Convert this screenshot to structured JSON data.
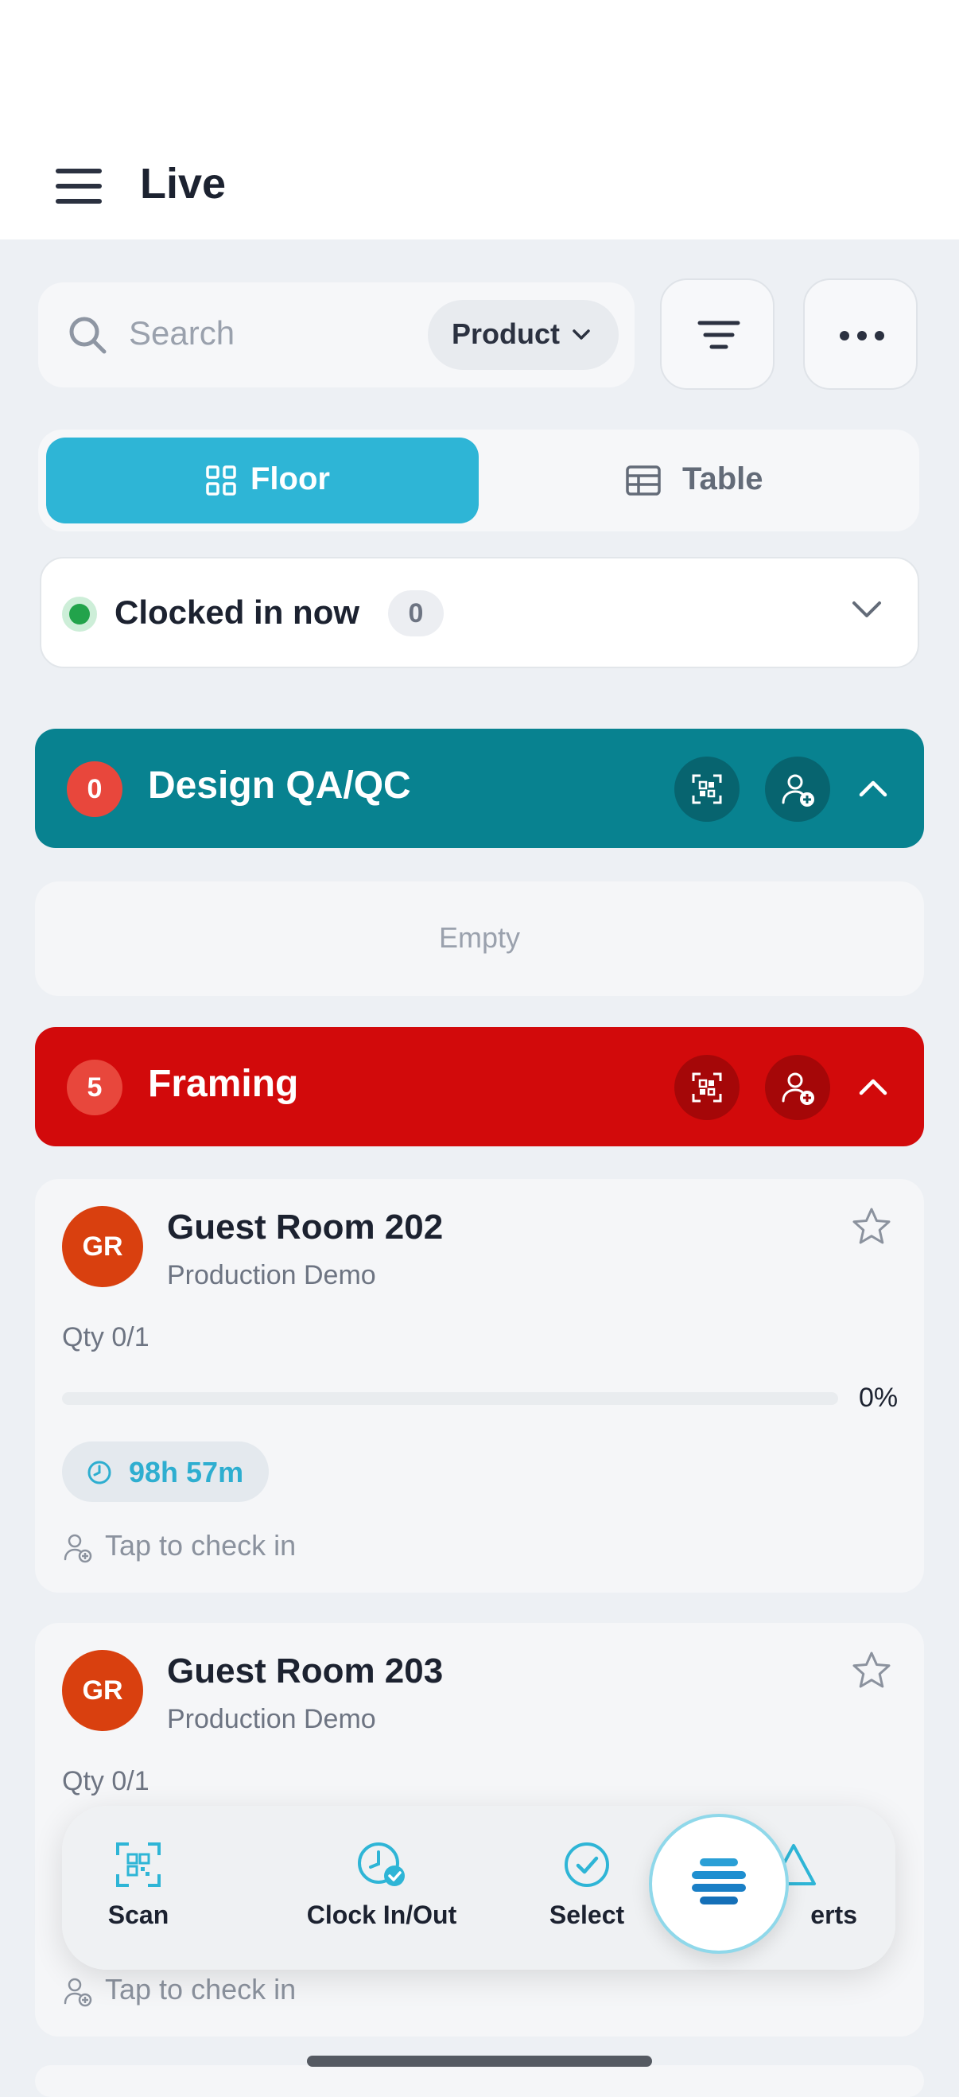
{
  "header": {
    "title": "Live"
  },
  "search": {
    "placeholder": "Search",
    "filter_label": "Product"
  },
  "view_toggle": {
    "floor_label": "Floor",
    "table_label": "Table"
  },
  "clocked_in": {
    "label": "Clocked in now",
    "count": "0"
  },
  "groups": [
    {
      "name": "Design QA/QC",
      "count": "0",
      "color": "#088290",
      "empty_label": "Empty"
    },
    {
      "name": "Framing",
      "count": "5",
      "color": "#d20a0b"
    }
  ],
  "cards": [
    {
      "initials": "GR",
      "title": "Guest Room 202",
      "subtitle": "Production Demo",
      "qty": "Qty 0/1",
      "progress": 0,
      "progress_label": "0%",
      "timer": "98h 57m",
      "checkin": "Tap to check in"
    },
    {
      "initials": "GR",
      "title": "Guest Room 203",
      "subtitle": "Production Demo",
      "qty": "Qty 0/1",
      "checkin": "Tap to check in"
    }
  ],
  "bottom_nav": {
    "scan": "Scan",
    "clock": "Clock In/Out",
    "select": "Select",
    "alerts": "erts"
  },
  "colors": {
    "accent": "#2eb5d6",
    "success": "#22a34b"
  }
}
